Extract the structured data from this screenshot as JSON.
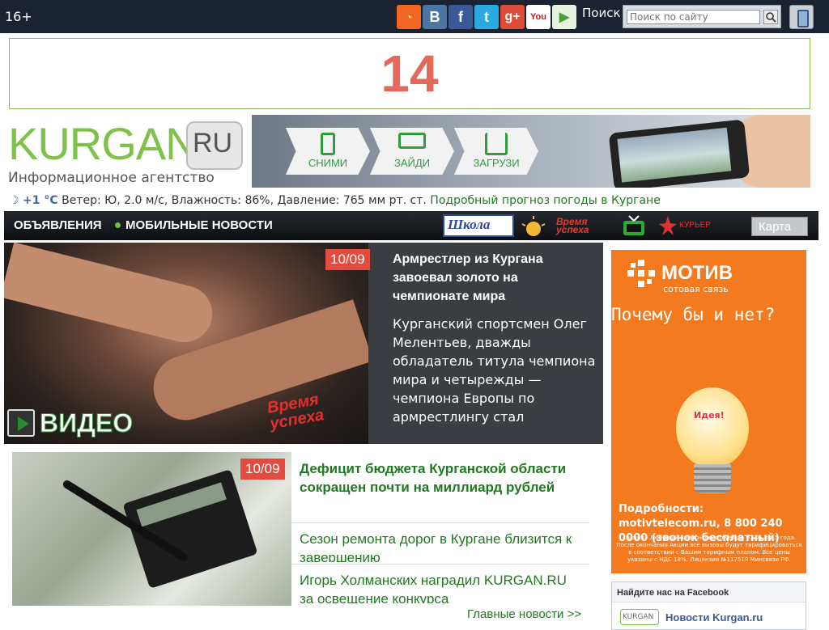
{
  "topbar": {
    "age_rating": "16+",
    "social": [
      {
        "name": "rss-icon",
        "glyph": "",
        "color": "#f26522"
      },
      {
        "name": "vkontakte-icon",
        "glyph": "B",
        "color": "#4c75a3"
      },
      {
        "name": "facebook-icon",
        "glyph": "f",
        "color": "#3b5998"
      },
      {
        "name": "twitter-icon",
        "glyph": "t",
        "color": "#2ba9e1"
      },
      {
        "name": "google-plus-icon",
        "glyph": "g+",
        "color": "#dd4b39"
      },
      {
        "name": "youtube-icon",
        "glyph": "You",
        "color": "#cc181e"
      },
      {
        "name": "google-play-icon",
        "glyph": "▶",
        "color": "#4c9f38"
      }
    ],
    "search_label": "Поиск",
    "search_placeholder": "Поиск по сайту"
  },
  "banner": {
    "number": "14"
  },
  "logo": {
    "name": "KURGAN",
    "domain": "RU",
    "subtitle": "Информационное агентство"
  },
  "promo": {
    "steps": [
      "СНИМИ",
      "ЗАЙДИ",
      "ЗАГРУЗИ"
    ]
  },
  "weather": {
    "temp": "+1 °C",
    "details": "Ветер: Ю, 2.0 м/с, Влажность: 86%, Давление: 765 мм рт. ст.",
    "link": "Подробный прогноз погоды в Кургане"
  },
  "nav": {
    "items": [
      "ОБЪЯВЛЕНИЯ",
      "МОБИЛЬНЫЕ НОВОСТИ"
    ],
    "partners": {
      "shkola": "Школа",
      "vremya": "Время успеха",
      "kurier": "КУРЬЕР"
    },
    "map": "Карта"
  },
  "feature": {
    "date": "10/09",
    "title": "Армрестлер из Кургана завоевал золото на чемпионате мира",
    "text": "Курганский спортсмен Олег Мелентьев, дважды обладатель титула чемпиона мира и четырежды — чемпиона Европы по армрестлингу стал",
    "video_label": "ВИДЕО",
    "brand": "Время успеха"
  },
  "news": {
    "date": "10/09",
    "main_title": "Дефицит бюджета Курганской области сокращен почти на миллиард рублей",
    "items": [
      "Сезон ремонта дорог в Кургане близится к завершению",
      "Игорь Холманских наградил KURGAN.RU за освещение конкурса"
    ],
    "all_link": "Главные новости >>"
  },
  "ad": {
    "brand": "МОТИВ",
    "tagline": "сотовая связь",
    "question": "Почему бы и нет?",
    "bulb_text": "Идея!",
    "more": "Подробности: motivtelecom.ru, 8 800 240 0000 (звонок бесплатный)",
    "fine_print": "«Акция - Любимый номер» действует до 01.01.2015 года. После окончания Акции все вызовы будут тарифицироваться в соответствии с Вашим тарифным планом. Все цены указаны с НДС 18%. Лицензия №117518 Минсвязи РФ."
  },
  "facebook": {
    "heading": "Найдите нас на Facebook",
    "thumb": "KURGAN",
    "page": "Новости Kurgan.ru"
  }
}
